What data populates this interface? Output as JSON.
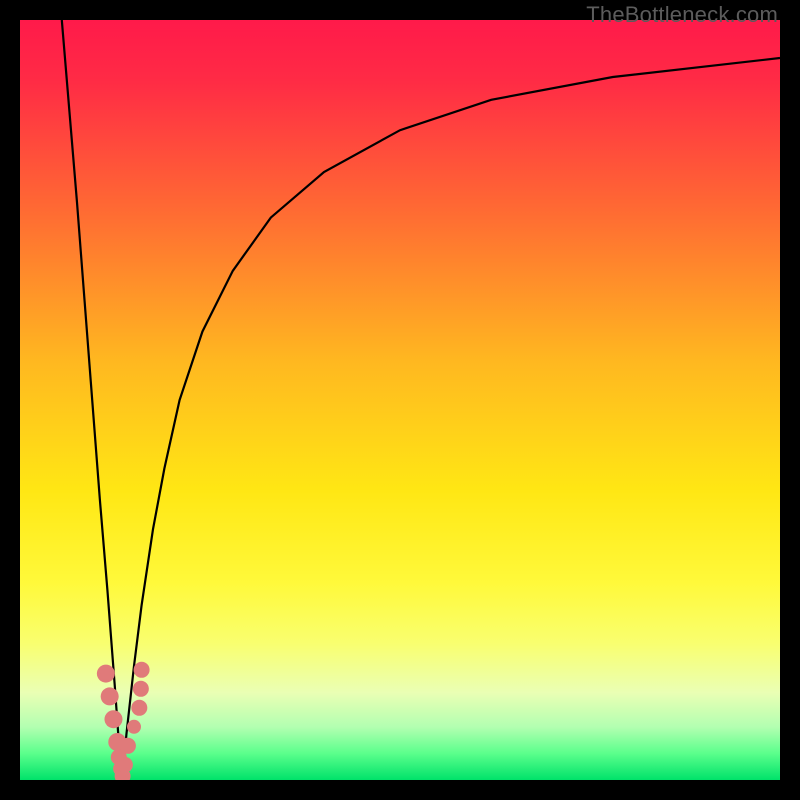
{
  "watermark": "TheBottleneck.com",
  "colors": {
    "frame": "#000000",
    "gradient_stops": [
      {
        "offset": 0.0,
        "color": "#ff1a4a"
      },
      {
        "offset": 0.08,
        "color": "#ff2b45"
      },
      {
        "offset": 0.25,
        "color": "#ff6a33"
      },
      {
        "offset": 0.45,
        "color": "#ffb820"
      },
      {
        "offset": 0.62,
        "color": "#ffe714"
      },
      {
        "offset": 0.74,
        "color": "#fff93a"
      },
      {
        "offset": 0.82,
        "color": "#f9ff6f"
      },
      {
        "offset": 0.885,
        "color": "#eaffb4"
      },
      {
        "offset": 0.93,
        "color": "#b3ffb1"
      },
      {
        "offset": 0.965,
        "color": "#5bff8c"
      },
      {
        "offset": 1.0,
        "color": "#00e26a"
      }
    ],
    "curve": "#000000",
    "marker_fill": "#e07a7a",
    "marker_stroke": "#c96060"
  },
  "chart_data": {
    "type": "line",
    "x_range": [
      0,
      100
    ],
    "y_range": [
      0,
      100
    ],
    "minimum_x": 13.5,
    "series": [
      {
        "name": "left-branch",
        "x": [
          5.5,
          6.5,
          7.5,
          8.5,
          9.5,
          10.5,
          11.5,
          12.5,
          13.0,
          13.5
        ],
        "y": [
          100,
          88,
          76,
          63,
          50,
          37,
          25,
          12,
          5,
          0
        ]
      },
      {
        "name": "right-branch",
        "x": [
          13.5,
          14.0,
          15.0,
          16.0,
          17.5,
          19.0,
          21.0,
          24.0,
          28.0,
          33.0,
          40.0,
          50.0,
          62.0,
          78.0,
          100.0
        ],
        "y": [
          0,
          6,
          15,
          23,
          33,
          41,
          50,
          59,
          67,
          74,
          80,
          85.5,
          89.5,
          92.5,
          95.0
        ]
      }
    ],
    "markers": {
      "name": "data-points",
      "x": [
        11.3,
        11.8,
        12.3,
        12.8,
        13.0,
        13.3,
        13.5,
        13.8,
        14.2,
        15.0,
        15.7,
        15.9,
        16.0
      ],
      "y": [
        14.0,
        11.0,
        8.0,
        5.0,
        3.0,
        1.5,
        0.5,
        2.0,
        4.5,
        7.0,
        9.5,
        12.0,
        14.5
      ],
      "r": [
        9,
        9,
        9,
        9,
        8,
        8,
        8,
        8,
        8,
        7,
        8,
        8,
        8
      ]
    }
  }
}
